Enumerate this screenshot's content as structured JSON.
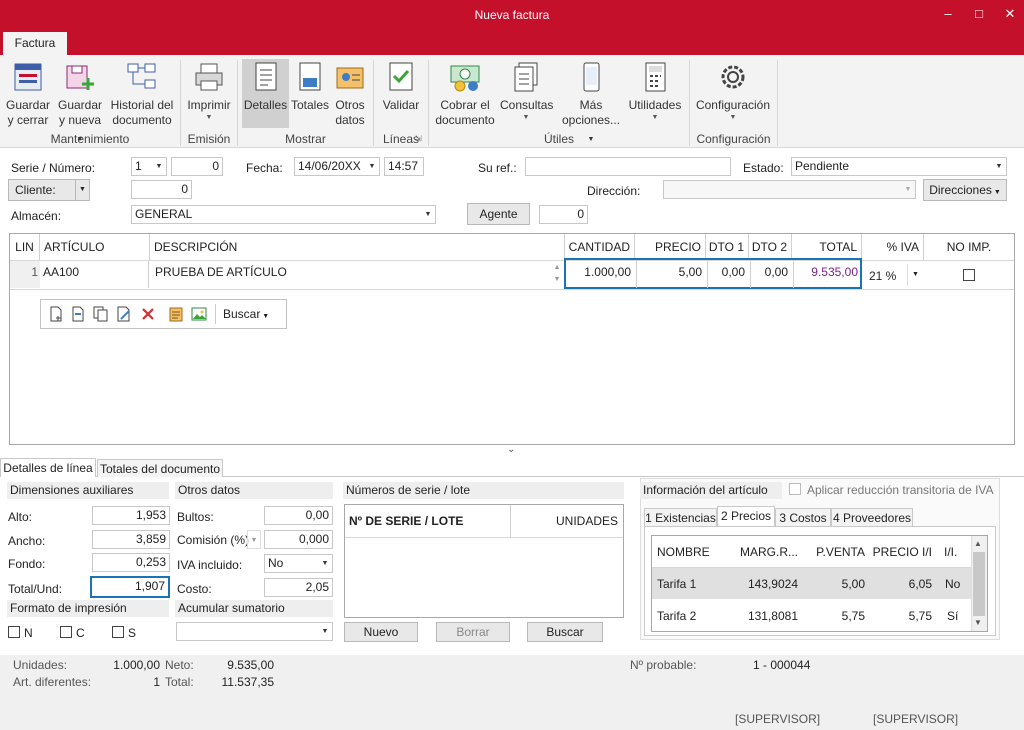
{
  "window": {
    "title": "Nueva factura",
    "minimize": "–",
    "maximize": "□",
    "close": "✕"
  },
  "ribbon": {
    "tab": "Factura",
    "buttons": {
      "guardar_cerrar": [
        "Guardar",
        "y cerrar"
      ],
      "guardar_nueva": [
        "Guardar",
        "y nueva"
      ],
      "historial": [
        "Historial del",
        "documento"
      ],
      "imprimir": [
        "Imprimir",
        ""
      ],
      "detalles": [
        "Detalles",
        ""
      ],
      "totales": [
        "Totales",
        ""
      ],
      "otros_datos": [
        "Otros",
        "datos"
      ],
      "validar": [
        "Validar",
        ""
      ],
      "cobrar": [
        "Cobrar el",
        "documento"
      ],
      "consultas": [
        "Consultas",
        ""
      ],
      "mas_opciones": [
        "Más",
        "opciones..."
      ],
      "utilidades": [
        "Utilidades",
        ""
      ],
      "configuracion": [
        "Configuración",
        ""
      ]
    },
    "groups": {
      "mantenimiento": "Mantenimiento",
      "emision": "Emisión",
      "mostrar": "Mostrar",
      "lineas": "Líneas",
      "utiles": "Útiles",
      "configuracion": "Configuración"
    }
  },
  "header": {
    "serie_label": "Serie / Número:",
    "serie_value": "1",
    "numero_value": "0",
    "fecha_label": "Fecha:",
    "fecha_value": "14/06/20XX",
    "hora_value": "14:57",
    "suref_label": "Su ref.:",
    "suref_value": "",
    "estado_label": "Estado:",
    "estado_value": "Pendiente",
    "cliente_label": "Cliente:",
    "cliente_value": "0",
    "direccion_label": "Dirección:",
    "direccion_value": "",
    "direcciones_btn": "Direcciones",
    "almacen_label": "Almacén:",
    "almacen_value": "GENERAL",
    "agente_btn": "Agente",
    "agente_value": "0"
  },
  "grid": {
    "columns": [
      "LIN",
      "ARTÍCULO",
      "DESCRIPCIÓN",
      "CANTIDAD",
      "PRECIO",
      "DTO 1",
      "DTO 2",
      "TOTAL",
      "% IVA",
      "NO IMP."
    ],
    "rows": [
      {
        "lin": "1",
        "articulo": "AA100",
        "descripcion": "PRUEBA DE ARTÍCULO",
        "cantidad": "1.000,00",
        "precio": "5,00",
        "dto1": "0,00",
        "dto2": "0,00",
        "total": "9.535,00",
        "iva": "21 %"
      }
    ],
    "buscar": "Buscar",
    "total_color": "#7b1f8a"
  },
  "bottom_tabs": {
    "detalles": "Detalles de línea",
    "totales": "Totales del documento"
  },
  "dimensiones": {
    "title": "Dimensiones auxiliares",
    "alto_label": "Alto:",
    "alto": "1,953",
    "ancho_label": "Ancho:",
    "ancho": "3,859",
    "fondo_label": "Fondo:",
    "fondo": "0,253",
    "total_label": "Total/Und:",
    "total": "1,907"
  },
  "otros": {
    "title": "Otros datos",
    "bultos_label": "Bultos:",
    "bultos": "0,00",
    "comision_label": "Comisión (%)",
    "comision": "0,000",
    "iva_label": "IVA incluido:",
    "iva": "No",
    "costo_label": "Costo:",
    "costo": "2,05"
  },
  "formato": {
    "title": "Formato de impresión",
    "n": "N",
    "c": "C",
    "s": "S"
  },
  "acumular": {
    "title": "Acumular sumatorio",
    "value": ""
  },
  "series": {
    "title": "Números de serie / lote",
    "col1": "Nº DE SERIE / LOTE",
    "col2": "UNIDADES",
    "nuevo": "Nuevo",
    "borrar": "Borrar",
    "buscar": "Buscar"
  },
  "info": {
    "title": "Información del artículo",
    "reduccion": "Aplicar reducción transitoria de IVA",
    "tabs": [
      "1 Existencias",
      "2 Precios",
      "3 Costos",
      "4 Proveedores"
    ],
    "cols": [
      "NOMBRE",
      "MARG.R...",
      "P.VENTA",
      "PRECIO I/I",
      "I/I."
    ],
    "rows": [
      [
        "Tarifa 1",
        "143,9024",
        "5,00",
        "6,05",
        "No"
      ],
      [
        "Tarifa 2",
        "131,8081",
        "5,75",
        "5,75",
        "Sí"
      ]
    ]
  },
  "status": {
    "unidades_label": "Unidades:",
    "unidades": "1.000,00",
    "neto_label": "Neto:",
    "neto": "9.535,00",
    "art_label": "Art. diferentes:",
    "art": "1",
    "total_label": "Total:",
    "total": "11.537,35",
    "nprob_label": "Nº probable:",
    "nprob": "1 - 000044",
    "sup1": "[SUPERVISOR]",
    "sup2": "[SUPERVISOR]"
  },
  "colors": {
    "accent": "#c5102c",
    "selection": "#1a73b5"
  }
}
